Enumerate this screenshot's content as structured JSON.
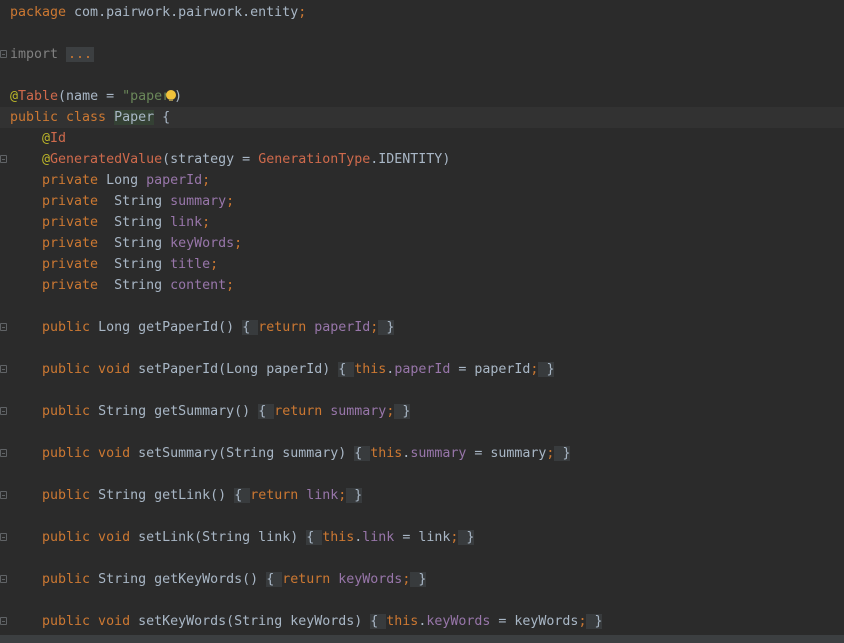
{
  "editor": {
    "lines": [
      {
        "tokens": [
          {
            "t": "package ",
            "c": "kw"
          },
          {
            "t": "com.pairwork.pairwork.entity",
            "c": "pkg"
          },
          {
            "t": ";",
            "c": "semi"
          }
        ]
      },
      {
        "tokens": []
      },
      {
        "fold": true,
        "tokens": [
          {
            "t": "import ",
            "c": "import"
          },
          {
            "t": "...",
            "c": "fold"
          }
        ]
      },
      {
        "tokens": []
      },
      {
        "tokens": [
          {
            "t": "@",
            "c": "ann"
          },
          {
            "t": "Table",
            "c": "annname"
          },
          {
            "t": "(name = ",
            "c": "plain"
          },
          {
            "t": "\"paper",
            "c": "str"
          },
          {
            "t": "",
            "c": "bulb"
          },
          {
            "t": ")",
            "c": "plain"
          }
        ]
      },
      {
        "current": true,
        "tokens": [
          {
            "t": "public class ",
            "c": "kw"
          },
          {
            "t": "Paper",
            "c": "class"
          },
          {
            "t": " {",
            "c": "plain"
          }
        ]
      },
      {
        "tokens": [
          {
            "t": "    @",
            "c": "ann"
          },
          {
            "t": "Id",
            "c": "annname"
          }
        ]
      },
      {
        "fold": true,
        "tokens": [
          {
            "t": "    @",
            "c": "ann"
          },
          {
            "t": "GeneratedValue",
            "c": "annname"
          },
          {
            "t": "(strategy = ",
            "c": "plain"
          },
          {
            "t": "GenerationType",
            "c": "enum"
          },
          {
            "t": ".IDENTITY)",
            "c": "plain"
          }
        ]
      },
      {
        "tokens": [
          {
            "t": "    private ",
            "c": "kw"
          },
          {
            "t": "Long ",
            "c": "type"
          },
          {
            "t": "paperId",
            "c": "field"
          },
          {
            "t": ";",
            "c": "semi"
          }
        ]
      },
      {
        "tokens": [
          {
            "t": "    private  ",
            "c": "kw"
          },
          {
            "t": "String ",
            "c": "type"
          },
          {
            "t": "summary",
            "c": "field"
          },
          {
            "t": ";",
            "c": "semi"
          }
        ]
      },
      {
        "tokens": [
          {
            "t": "    private  ",
            "c": "kw"
          },
          {
            "t": "String ",
            "c": "type"
          },
          {
            "t": "link",
            "c": "field"
          },
          {
            "t": ";",
            "c": "semi"
          }
        ]
      },
      {
        "tokens": [
          {
            "t": "    private  ",
            "c": "kw"
          },
          {
            "t": "String ",
            "c": "type"
          },
          {
            "t": "keyWords",
            "c": "field"
          },
          {
            "t": ";",
            "c": "semi"
          }
        ]
      },
      {
        "tokens": [
          {
            "t": "    private  ",
            "c": "kw"
          },
          {
            "t": "String ",
            "c": "type"
          },
          {
            "t": "title",
            "c": "field"
          },
          {
            "t": ";",
            "c": "semi"
          }
        ]
      },
      {
        "tokens": [
          {
            "t": "    private  ",
            "c": "kw"
          },
          {
            "t": "String ",
            "c": "type"
          },
          {
            "t": "content",
            "c": "field"
          },
          {
            "t": ";",
            "c": "semi"
          }
        ]
      },
      {
        "tokens": []
      },
      {
        "fold": true,
        "tokens": [
          {
            "t": "    public ",
            "c": "kw"
          },
          {
            "t": "Long ",
            "c": "type"
          },
          {
            "t": "getPaperId",
            "c": "method"
          },
          {
            "t": "() ",
            "c": "plain"
          },
          {
            "t": "{ ",
            "c": "brace"
          },
          {
            "t": "return ",
            "c": "kw"
          },
          {
            "t": "paperId",
            "c": "field"
          },
          {
            "t": ";",
            "c": "semi"
          },
          {
            "t": " }",
            "c": "brace"
          }
        ]
      },
      {
        "tokens": []
      },
      {
        "fold": true,
        "tokens": [
          {
            "t": "    public void ",
            "c": "kw"
          },
          {
            "t": "setPaperId",
            "c": "method"
          },
          {
            "t": "(Long paperId) ",
            "c": "plain"
          },
          {
            "t": "{ ",
            "c": "brace"
          },
          {
            "t": "this",
            "c": "kw"
          },
          {
            "t": ".",
            "c": "plain"
          },
          {
            "t": "paperId",
            "c": "field"
          },
          {
            "t": " = paperId",
            "c": "plain"
          },
          {
            "t": ";",
            "c": "semi"
          },
          {
            "t": " }",
            "c": "brace"
          }
        ]
      },
      {
        "tokens": []
      },
      {
        "fold": true,
        "tokens": [
          {
            "t": "    public ",
            "c": "kw"
          },
          {
            "t": "String ",
            "c": "type"
          },
          {
            "t": "getSummary",
            "c": "method"
          },
          {
            "t": "() ",
            "c": "plain"
          },
          {
            "t": "{ ",
            "c": "brace"
          },
          {
            "t": "return ",
            "c": "kw"
          },
          {
            "t": "summary",
            "c": "field"
          },
          {
            "t": ";",
            "c": "semi"
          },
          {
            "t": " }",
            "c": "brace"
          }
        ]
      },
      {
        "tokens": []
      },
      {
        "fold": true,
        "tokens": [
          {
            "t": "    public void ",
            "c": "kw"
          },
          {
            "t": "setSummary",
            "c": "method"
          },
          {
            "t": "(String summary) ",
            "c": "plain"
          },
          {
            "t": "{ ",
            "c": "brace"
          },
          {
            "t": "this",
            "c": "kw"
          },
          {
            "t": ".",
            "c": "plain"
          },
          {
            "t": "summary",
            "c": "field"
          },
          {
            "t": " = summary",
            "c": "plain"
          },
          {
            "t": ";",
            "c": "semi"
          },
          {
            "t": " }",
            "c": "brace"
          }
        ]
      },
      {
        "tokens": []
      },
      {
        "fold": true,
        "tokens": [
          {
            "t": "    public ",
            "c": "kw"
          },
          {
            "t": "String ",
            "c": "type"
          },
          {
            "t": "getLink",
            "c": "method"
          },
          {
            "t": "() ",
            "c": "plain"
          },
          {
            "t": "{ ",
            "c": "brace"
          },
          {
            "t": "return ",
            "c": "kw"
          },
          {
            "t": "link",
            "c": "field"
          },
          {
            "t": ";",
            "c": "semi"
          },
          {
            "t": " }",
            "c": "brace"
          }
        ]
      },
      {
        "tokens": []
      },
      {
        "fold": true,
        "tokens": [
          {
            "t": "    public void ",
            "c": "kw"
          },
          {
            "t": "setLink",
            "c": "method"
          },
          {
            "t": "(String link) ",
            "c": "plain"
          },
          {
            "t": "{ ",
            "c": "brace"
          },
          {
            "t": "this",
            "c": "kw"
          },
          {
            "t": ".",
            "c": "plain"
          },
          {
            "t": "link",
            "c": "field"
          },
          {
            "t": " = link",
            "c": "plain"
          },
          {
            "t": ";",
            "c": "semi"
          },
          {
            "t": " }",
            "c": "brace"
          }
        ]
      },
      {
        "tokens": []
      },
      {
        "fold": true,
        "tokens": [
          {
            "t": "    public ",
            "c": "kw"
          },
          {
            "t": "String ",
            "c": "type"
          },
          {
            "t": "getKeyWords",
            "c": "method"
          },
          {
            "t": "() ",
            "c": "plain"
          },
          {
            "t": "{ ",
            "c": "brace"
          },
          {
            "t": "return ",
            "c": "kw"
          },
          {
            "t": "keyWords",
            "c": "field"
          },
          {
            "t": ";",
            "c": "semi"
          },
          {
            "t": " }",
            "c": "brace"
          }
        ]
      },
      {
        "tokens": []
      },
      {
        "fold": true,
        "tokens": [
          {
            "t": "    public void ",
            "c": "kw"
          },
          {
            "t": "setKeyWords",
            "c": "method"
          },
          {
            "t": "(String keyWords) ",
            "c": "plain"
          },
          {
            "t": "{ ",
            "c": "brace"
          },
          {
            "t": "this",
            "c": "kw"
          },
          {
            "t": ".",
            "c": "plain"
          },
          {
            "t": "keyWords",
            "c": "field"
          },
          {
            "t": " = keyWords",
            "c": "plain"
          },
          {
            "t": ";",
            "c": "semi"
          },
          {
            "t": " }",
            "c": "brace"
          }
        ]
      }
    ]
  },
  "colors": {
    "background": "#2b2b2b",
    "keyword": "#cc7832",
    "field": "#9876aa",
    "annotation": "#bbb529",
    "string": "#6a8759",
    "text": "#a9b7c6",
    "current_line": "#323232"
  },
  "icons": {
    "fold": "fold-marker-icon",
    "intention": "lightbulb-icon"
  }
}
